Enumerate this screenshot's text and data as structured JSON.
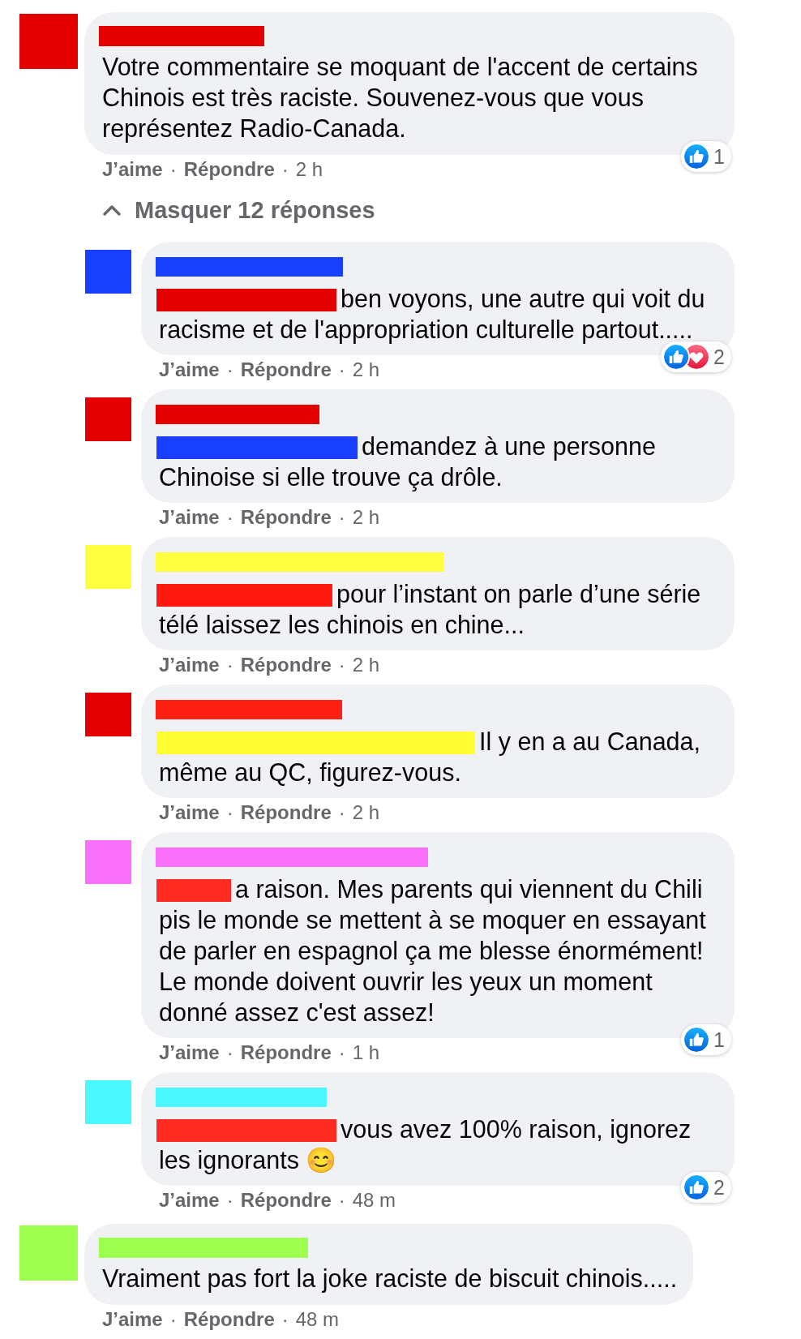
{
  "comments": [
    {
      "avatar": {
        "color": "#e40000"
      },
      "name_bar": {
        "color": "#e40000"
      },
      "text": "Votre commentaire se moquant de l'accent de certains Chinois est très raciste. Souvenez-vous que vous représentez Radio-Canada.",
      "like": "J’aime",
      "separators": [
        "·",
        "·"
      ],
      "reply": "Répondre",
      "time": "2 h",
      "reactions": {
        "icons": [
          {
            "kind": "like"
          }
        ],
        "count": "1"
      },
      "replies_toggle": {
        "label": "Masquer 12 réponses",
        "expanded": true
      },
      "replies": [
        {
          "avatar": {
            "color": "#1a40ff"
          },
          "name_bar": {
            "color": "#1a40ff"
          },
          "mention": {
            "color": "#e40000"
          },
          "text": "ben voyons, une autre qui voit du racisme et de l'appropriation culturelle partout.....",
          "like": "J’aime",
          "separators": [
            "·",
            "·"
          ],
          "reply": "Répondre",
          "time": "2 h",
          "reactions": {
            "icons": [
              {
                "kind": "like"
              },
              {
                "kind": "love"
              }
            ],
            "count": "2"
          }
        },
        {
          "avatar": {
            "color": "#e40000"
          },
          "name_bar": {
            "color": "#e40000"
          },
          "mention": {
            "color": "#1a40ff"
          },
          "text": "demandez à une personne Chinoise si elle trouve ça drôle.",
          "like": "J’aime",
          "separators": [
            "·",
            "·"
          ],
          "reply": "Répondre",
          "time": "2 h"
        },
        {
          "avatar": {
            "color": "#ffff40"
          },
          "name_bar": {
            "color": "#ffff40"
          },
          "mention": {
            "color": "#ff1a10"
          },
          "text": "pour l’instant on parle d’une série télé laissez les chinois en chine...",
          "like": "J’aime",
          "separators": [
            "·",
            "·"
          ],
          "reply": "Répondre",
          "time": "2 h"
        },
        {
          "avatar": {
            "color": "#e40000"
          },
          "name_bar": {
            "color": "#ff2015"
          },
          "mention": {
            "color": "#ffff33"
          },
          "text": "Il y en a au Canada, même au QC, figurez-vous.",
          "like": "J’aime",
          "separators": [
            "·",
            "·"
          ],
          "reply": "Répondre",
          "time": "2 h"
        },
        {
          "avatar": {
            "color": "#fb71fb"
          },
          "name_bar": {
            "color": "#fb71fb"
          },
          "mention": {
            "color": "#ff2a20"
          },
          "text": "a raison. Mes parents qui viennent du Chili pis le monde se mettent à se moquer en essayant de parler en espagnol ça me blesse énormément! Le monde doivent ouvrir les yeux un moment donné assez c'est assez!",
          "like": "J’aime",
          "separators": [
            "·",
            "·"
          ],
          "reply": "Répondre",
          "time": "1 h",
          "reactions": {
            "icons": [
              {
                "kind": "like"
              }
            ],
            "count": "1"
          }
        },
        {
          "avatar": {
            "color": "#4cf8ff"
          },
          "name_bar": {
            "color": "#4cf8ff"
          },
          "mention": {
            "color": "#ff2a20"
          },
          "text": "vous avez 100% raison, ignorez les ignorants 😊",
          "like": "J’aime",
          "separators": [
            "·",
            "·"
          ],
          "reply": "Répondre",
          "time": "48 m",
          "reactions": {
            "icons": [
              {
                "kind": "like"
              }
            ],
            "count": "2"
          }
        }
      ]
    },
    {
      "avatar": {
        "color": "#9eff4f"
      },
      "name_bar": {
        "color": "#9eff4f"
      },
      "text": "Vraiment pas fort la joke raciste de biscuit chinois.....",
      "like": "J’aime",
      "separators": [
        "·",
        "·"
      ],
      "reply": "Répondre",
      "time": "48 m"
    }
  ]
}
